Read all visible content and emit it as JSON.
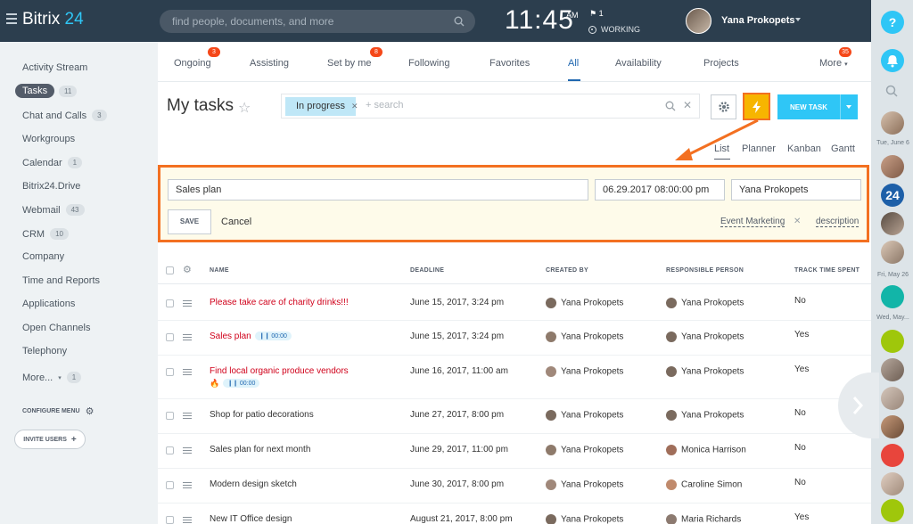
{
  "header": {
    "logo_name": "Bitrix",
    "logo_number": "24",
    "search_placeholder": "find people, documents, and more",
    "time": "11:45",
    "ampm": "AM",
    "flag_count": "1",
    "status": "WORKING",
    "user_name": "Yana Prokopets"
  },
  "sidebar": {
    "items": [
      {
        "label": "Activity Stream",
        "badge": ""
      },
      {
        "label": "Tasks",
        "badge": "11"
      },
      {
        "label": "Chat and Calls",
        "badge": "3"
      },
      {
        "label": "Workgroups",
        "badge": ""
      },
      {
        "label": "Calendar",
        "badge": "1"
      },
      {
        "label": "Bitrix24.Drive",
        "badge": ""
      },
      {
        "label": "Webmail",
        "badge": "43"
      },
      {
        "label": "CRM",
        "badge": "10"
      },
      {
        "label": "Company",
        "badge": ""
      },
      {
        "label": "Time and Reports",
        "badge": ""
      },
      {
        "label": "Applications",
        "badge": ""
      },
      {
        "label": "Open Channels",
        "badge": ""
      },
      {
        "label": "Telephony",
        "badge": ""
      },
      {
        "label": "More...",
        "badge": "1"
      }
    ],
    "configure_menu": "CONFIGURE MENU",
    "invite_users": "INVITE USERS"
  },
  "tabs": [
    {
      "label": "Ongoing",
      "badge": "3"
    },
    {
      "label": "Assisting",
      "badge": ""
    },
    {
      "label": "Set by me",
      "badge": "8"
    },
    {
      "label": "Following",
      "badge": ""
    },
    {
      "label": "Favorites",
      "badge": ""
    },
    {
      "label": "All",
      "badge": ""
    },
    {
      "label": "Availability",
      "badge": ""
    },
    {
      "label": "Projects",
      "badge": ""
    },
    {
      "label": "More",
      "badge": "35"
    }
  ],
  "toolbar": {
    "title": "My tasks",
    "filter_chip": "In progress",
    "search_placeholder": "+ search",
    "new_task": "NEW TASK"
  },
  "views": [
    "List",
    "Planner",
    "Kanban",
    "Gantt"
  ],
  "quick_task": {
    "title_value": "Sales plan",
    "deadline_value": "06.29.2017 08:00:00 pm",
    "responsible_value": "Yana Prokopets",
    "save": "SAVE",
    "cancel": "Cancel",
    "tag": "Event Marketing",
    "description": "description"
  },
  "table": {
    "columns": [
      "NAME",
      "DEADLINE",
      "CREATED BY",
      "RESPONSIBLE PERSON",
      "TRACK TIME SPENT"
    ],
    "rows": [
      {
        "name": "Please take care of charity drinks!!!",
        "overdue": true,
        "timer": "",
        "deadline": "June 15, 2017, 3:24 pm",
        "created_by": "Yana Prokopets",
        "responsible": "Yana Prokopets",
        "track": "No"
      },
      {
        "name": "Sales plan",
        "overdue": true,
        "timer": "00:00",
        "deadline": "June 15, 2017, 3:24 pm",
        "created_by": "Yana Prokopets",
        "responsible": "Yana Prokopets",
        "track": "Yes"
      },
      {
        "name": "Find local organic produce vendors",
        "overdue": true,
        "timer": "00:00",
        "deadline": "June 16, 2017, 11:00 am",
        "created_by": "Yana Prokopets",
        "responsible": "Yana Prokopets",
        "track": "Yes"
      },
      {
        "name": "Shop for patio decorations",
        "overdue": false,
        "timer": "",
        "deadline": "June 27, 2017, 8:00 pm",
        "created_by": "Yana Prokopets",
        "responsible": "Yana Prokopets",
        "track": "No"
      },
      {
        "name": "Sales plan for next month",
        "overdue": false,
        "timer": "",
        "deadline": "June 29, 2017, 11:00 pm",
        "created_by": "Yana Prokopets",
        "responsible": "Monica Harrison",
        "track": "No"
      },
      {
        "name": "Modern design sketch",
        "overdue": false,
        "timer": "",
        "deadline": "June 30, 2017, 8:00 pm",
        "created_by": "Yana Prokopets",
        "responsible": "Caroline Simon",
        "track": "No"
      },
      {
        "name": "New IT Office design",
        "overdue": false,
        "timer": "",
        "deadline": "August 21, 2017, 8:00 pm",
        "created_by": "Yana Prokopets",
        "responsible": "Maria Richards",
        "track": "Yes"
      }
    ]
  },
  "rightbar": {
    "help": "?",
    "date1": "Tue, June 6",
    "date2": "Fri, May 26",
    "date3": "Wed, May...",
    "badge24": "24"
  },
  "colors": {
    "header_bg": "#2c3e4e",
    "accent": "#2fc6f6",
    "highlight": "#f37021",
    "overdue": "#d0021b"
  }
}
